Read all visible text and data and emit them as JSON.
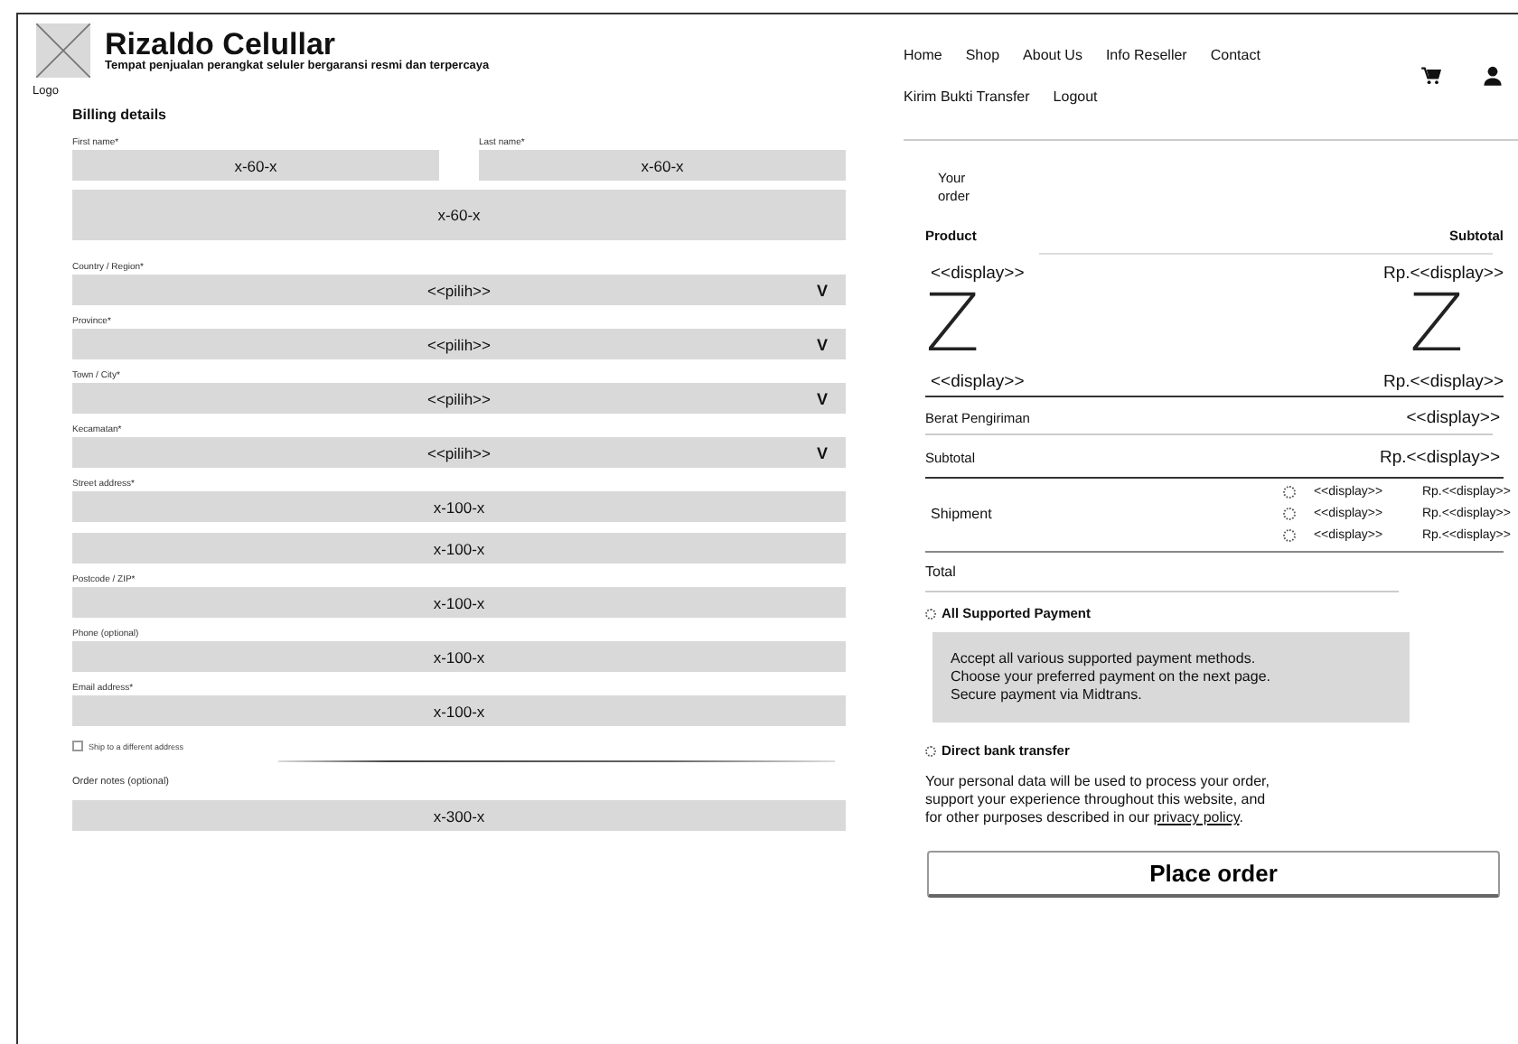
{
  "header": {
    "logo_caption": "Logo",
    "title": "Rizaldo Celullar",
    "tagline": "Tempat penjualan perangkat seluler bergaransi resmi dan terpercaya"
  },
  "nav": {
    "links": [
      "Home",
      "Shop",
      "About Us",
      "Info Reseller",
      "Contact",
      "Kirim Bukti Transfer",
      "Logout"
    ]
  },
  "billing": {
    "title": "Billing details",
    "name_fields": [
      {
        "label": "First name*",
        "value": "x-60-x"
      },
      {
        "label": "Last name*",
        "value": "x-60-x"
      }
    ],
    "fields": [
      {
        "kind": "wide",
        "value": "x-60-x"
      },
      {
        "kind": "select",
        "label": "Country / Region*",
        "value": "<<pilih>>",
        "caret": "V"
      },
      {
        "kind": "select",
        "label": "Province*",
        "value": "<<pilih>>",
        "caret": "V"
      },
      {
        "kind": "select",
        "label": "Town / City*",
        "value": "<<pilih>>",
        "caret": "V"
      },
      {
        "kind": "select",
        "label": "Kecamatan*",
        "value": "<<pilih>>",
        "caret": "V"
      },
      {
        "kind": "text",
        "label": "Street address*",
        "value": "x-100-x"
      },
      {
        "kind": "text",
        "value": "x-100-x"
      },
      {
        "kind": "text",
        "label": "Postcode / ZIP*",
        "value": "x-100-x"
      },
      {
        "kind": "text",
        "label": "Phone (optional)",
        "value": "x-100-x"
      },
      {
        "kind": "text",
        "label": "Email address*",
        "value": "x-100-x"
      }
    ],
    "ship_different": {
      "label": "Ship to a different address",
      "checked": false
    },
    "order_notes": {
      "label": "Order notes (optional)",
      "value": "x-300-x"
    }
  },
  "order": {
    "title": "Your\norder",
    "columns": [
      "Product",
      "Subtotal"
    ],
    "rows": [
      {
        "kind": "item",
        "name": "<<display>>",
        "subtotal": "Rp.<<display>>"
      },
      {
        "kind": "glyph",
        "name": "Z",
        "subtotal": "Z"
      },
      {
        "kind": "item",
        "name": "<<display>>",
        "subtotal": "Rp.<<display>>"
      }
    ],
    "weight": {
      "label": "Berat Pengiriman",
      "value": "<<display>>"
    },
    "subtotal": {
      "label": "Subtotal",
      "value": "Rp.<<display>>"
    },
    "shipment": {
      "label": "Shipment",
      "options": [
        {
          "name": "<<display>>",
          "price": "Rp.<<display>>",
          "selected": false
        },
        {
          "name": "<<display>>",
          "price": "Rp.<<display>>",
          "selected": false
        },
        {
          "name": "<<display>>",
          "price": "Rp.<<display>>",
          "selected": false
        }
      ]
    },
    "total": {
      "label": "Total"
    },
    "payment_methods": [
      {
        "label": "All Supported Payment",
        "selected": false,
        "description": "Accept all various supported payment methods.\nChoose your preferred payment on the next page.\nSecure payment via Midtrans."
      },
      {
        "label": "Direct bank transfer",
        "selected": false
      }
    ],
    "privacy": {
      "text": "Your personal data will be used to process your order,\nsupport your experience throughout this website, and\nfor other purposes described in our ",
      "link": "privacy policy",
      "after": "."
    },
    "place_order": "Place order"
  }
}
